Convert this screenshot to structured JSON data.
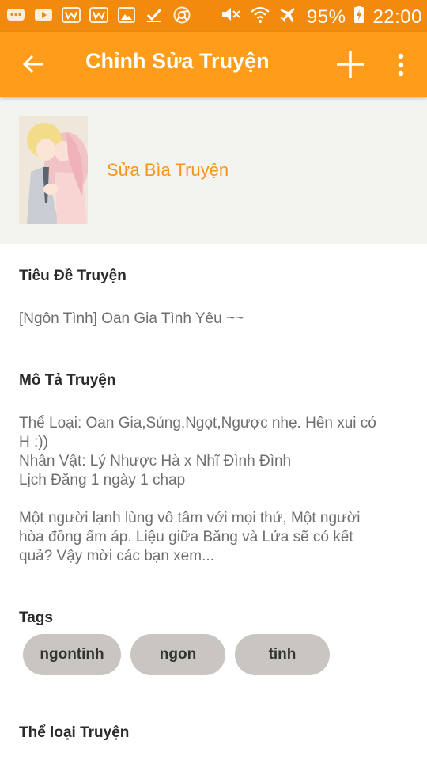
{
  "status_bar": {
    "battery": "95%",
    "time": "22:00",
    "left_icons": [
      "chat-icon",
      "youtube-icon",
      "w-icon",
      "w-icon",
      "gallery-icon",
      "check-icon",
      "chrome-icon"
    ],
    "right_icons": [
      "mute-icon",
      "wifi-icon",
      "airplane-icon",
      "battery-charging-icon"
    ]
  },
  "toolbar": {
    "title": "Chỉnh Sửa Truyện",
    "back_icon": "arrow-left-icon",
    "add_icon": "plus-icon",
    "more_icon": "more-vert-icon"
  },
  "cover": {
    "edit_label": "Sửa Bìa Truyện"
  },
  "story": {
    "title_label": "Tiêu Đề Truyện",
    "title_value": "[Ngôn Tình] Oan Gia Tình Yêu ~~",
    "desc_label": "Mô Tả Truyện",
    "desc_lines": [
      "Thể Loại: Oan Gia,Sủng,Ngọt,Ngược nhẹ. Hên xui có",
      "H :))",
      "Nhân Vật: Lý Nhược Hà x Nhĩ Đình Đình",
      "Lịch Đăng 1 ngày 1 chap",
      "",
      "Một người lạnh lùng vô tâm với mọi thứ, Một người",
      "hòa đồng ấm áp. Liệu giữa Băng và Lửa sẽ có kết",
      "quả? Vậy mời các bạn xem..."
    ],
    "tags_label": "Tags",
    "tags": [
      "ngontinh",
      "ngon",
      "tinh"
    ],
    "genre_label": "Thể loại Truyện"
  },
  "colors": {
    "status_bar": "#f28a0d",
    "toolbar": "#ff9c1a",
    "accent": "#f7941d",
    "tag_bg": "#c9c5c0"
  }
}
